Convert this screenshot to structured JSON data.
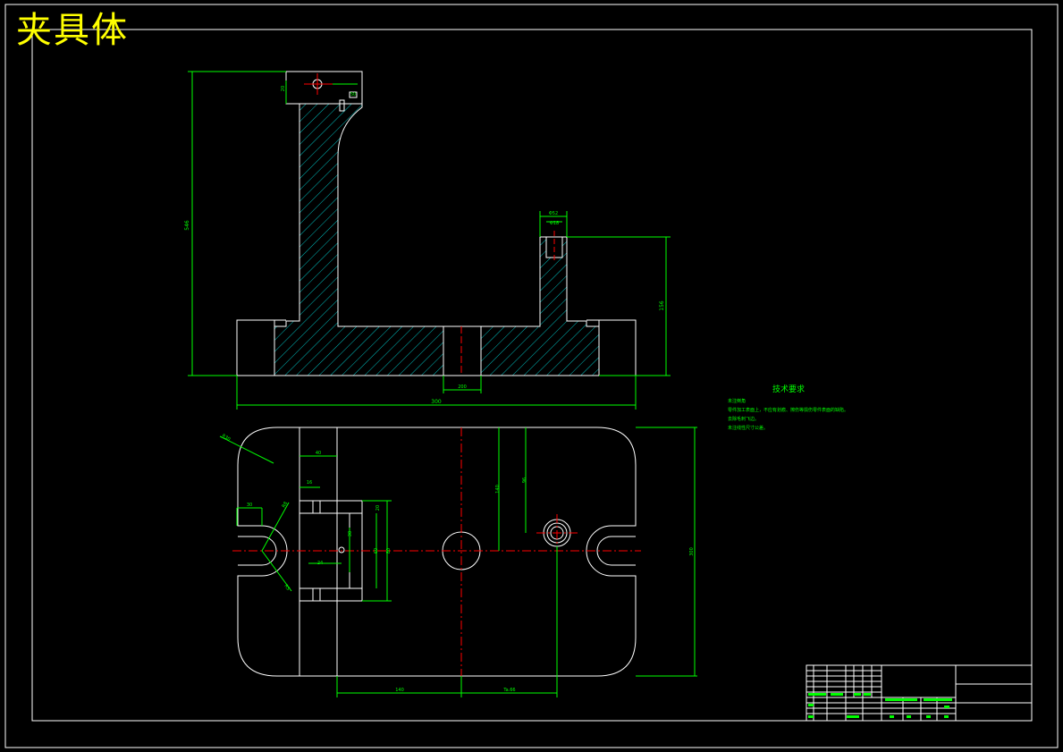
{
  "title": "夹具体",
  "technical_requirements": {
    "heading": "技术要求",
    "lines": [
      "未注倒角",
      "零件加工表面上，不应有划痕、擦伤等损伤零件表面的缺陷。",
      "去除毛刺飞边。",
      "未注线性尺寸公差。"
    ]
  },
  "dimensions": {
    "overall_height": "546",
    "top_small": "20",
    "top_right": "50",
    "base_width": "300",
    "center_hole": "200",
    "post_width_outer": "Φ52",
    "post_width_inner": "Φ18",
    "post_height": "156",
    "col_width": "40",
    "slot_16": "16",
    "slot_dim_a": "30",
    "r_slot": "R8",
    "r_slot_b": "R5",
    "corner_r": "R30",
    "box_a": "20",
    "box_b": "60",
    "box_c": "80",
    "mid_w": "24",
    "mid_h": "30",
    "v_right_a": "140",
    "v_right_b": "96",
    "overall_plan_h": "300",
    "bottom_left": "140",
    "bottom_right": "Ta.66"
  },
  "colors": {
    "outline": "#ffffff",
    "dimension": "#00ff00",
    "centerline": "#ff0000",
    "hatch": "#00cccc",
    "title": "#ffff00"
  }
}
